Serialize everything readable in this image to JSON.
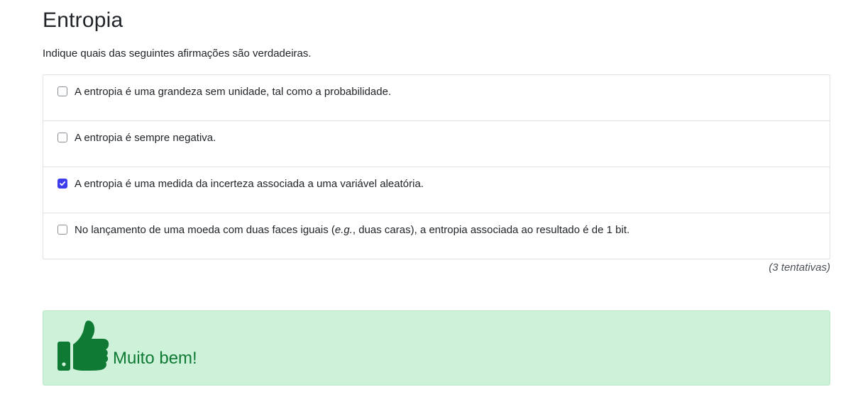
{
  "question": {
    "title": "Entropia",
    "prompt": "Indique quais das seguintes afirmações são verdadeiras.",
    "options": [
      {
        "label": "A entropia é uma grandeza sem unidade, tal como a probabilidade.",
        "checked": false
      },
      {
        "label": "A entropia é sempre negativa.",
        "checked": false
      },
      {
        "label": "A entropia é uma medida da incerteza associada a uma variável aleatória.",
        "checked": true
      },
      {
        "label_before": "No lançamento de uma moeda com duas faces iguais (",
        "label_em": "e.g.",
        "label_after": ", duas caras), a entropia associada ao resultado é de 1 bit.",
        "checked": false
      }
    ],
    "attempts": "(3 tentativas)"
  },
  "feedback": {
    "icon": "thumbs-up-icon",
    "message": "Muito bem!",
    "color": "#0f7a33",
    "background": "#cdf1d9"
  },
  "colors": {
    "checkbox_checked": "#3d3ded"
  }
}
